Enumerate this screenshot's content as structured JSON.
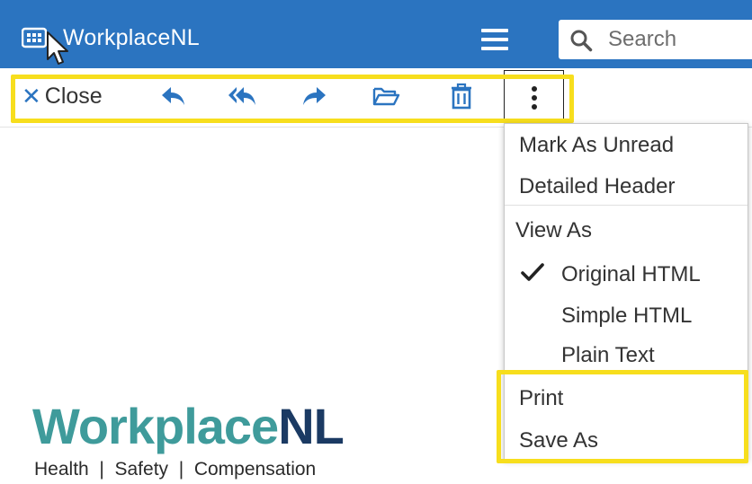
{
  "app": {
    "title": "WorkplaceNL",
    "icon": "mail-grid-icon",
    "bar_color": "#2b74c0"
  },
  "search": {
    "placeholder": "Search"
  },
  "toolbar": {
    "close_label": "Close",
    "icons": [
      "reply-icon",
      "reply-all-icon",
      "forward-icon",
      "move-folder-icon",
      "delete-icon",
      "more-options-icon"
    ],
    "accent": "#2b74c0"
  },
  "menu": {
    "mark_unread": "Mark As Unread",
    "detailed_header": "Detailed Header",
    "view_as": "View As",
    "original_html": "Original HTML",
    "simple_html": "Simple HTML",
    "plain_text": "Plain Text",
    "print": "Print",
    "save_as": "Save As",
    "selected_view": "Original HTML"
  },
  "email_body": {
    "logo_part1": "Workplace",
    "logo_part2": "NL",
    "tagline": "Health  |  Safety  |  Compensation",
    "logo_colors": [
      "#3f9b9b",
      "#1b3a63"
    ]
  },
  "highlight_color": "#f7de1d"
}
